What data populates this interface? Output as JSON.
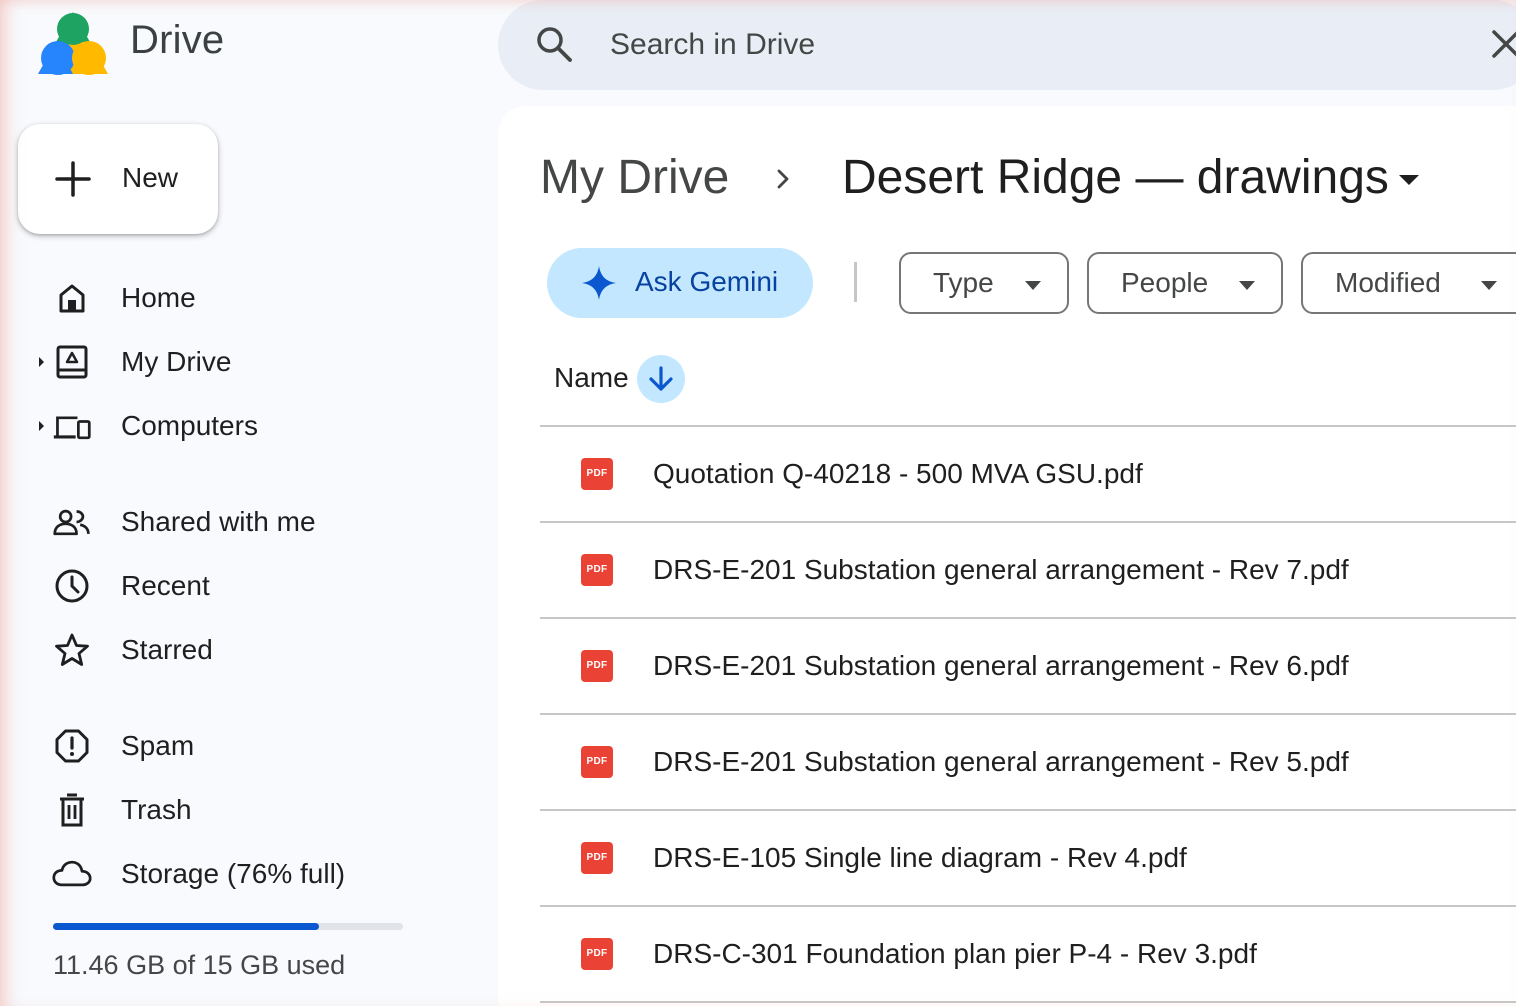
{
  "app": {
    "title": "Drive",
    "logo_icon": "google-drive-logo"
  },
  "search": {
    "placeholder": "Search in Drive",
    "value": ""
  },
  "new_button": {
    "label": "New"
  },
  "sidebar": {
    "items": [
      {
        "label": "Home",
        "icon": "home-icon",
        "has_caret": false
      },
      {
        "label": "My Drive",
        "icon": "my-drive-icon",
        "has_caret": true
      },
      {
        "label": "Computers",
        "icon": "computers-icon",
        "has_caret": true
      },
      {
        "label": "Shared with me",
        "icon": "shared-people-icon",
        "has_caret": false
      },
      {
        "label": "Recent",
        "icon": "clock-icon",
        "has_caret": false
      },
      {
        "label": "Starred",
        "icon": "star-icon",
        "has_caret": false
      },
      {
        "label": "Spam",
        "icon": "spam-icon",
        "has_caret": false
      },
      {
        "label": "Trash",
        "icon": "trash-icon",
        "has_caret": false
      },
      {
        "label": "Storage (76% full)",
        "icon": "cloud-icon",
        "has_caret": false
      }
    ]
  },
  "storage": {
    "used_fraction": 0.76,
    "text": "11.46 GB of 15 GB used"
  },
  "breadcrumb": {
    "root": "My Drive",
    "current": "Desert Ridge — drawings"
  },
  "toolbar": {
    "gemini_label": "Ask Gemini",
    "filters": [
      {
        "label": "Type"
      },
      {
        "label": "People"
      },
      {
        "label": "Modified"
      }
    ]
  },
  "file_list": {
    "column_name": "Name",
    "sort": "descending",
    "files": [
      {
        "name": "Quotation Q-40218 - 500 MVA GSU.pdf",
        "type_badge": "PDF"
      },
      {
        "name": "DRS-E-201 Substation general arrangement - Rev 7.pdf",
        "type_badge": "PDF"
      },
      {
        "name": "DRS-E-201 Substation general arrangement - Rev 6.pdf",
        "type_badge": "PDF"
      },
      {
        "name": "DRS-E-201 Substation general arrangement - Rev 5.pdf",
        "type_badge": "PDF"
      },
      {
        "name": "DRS-E-105 Single line diagram - Rev 4.pdf",
        "type_badge": "PDF"
      },
      {
        "name": "DRS-C-301 Foundation plan pier P-4 - Rev 3.pdf",
        "type_badge": "PDF"
      }
    ]
  },
  "colors": {
    "accent_blue": "#0b57d0",
    "gemini_chip": "#c2e7ff",
    "pdf_red": "#ea4335",
    "search_bg": "#e9eef6"
  }
}
